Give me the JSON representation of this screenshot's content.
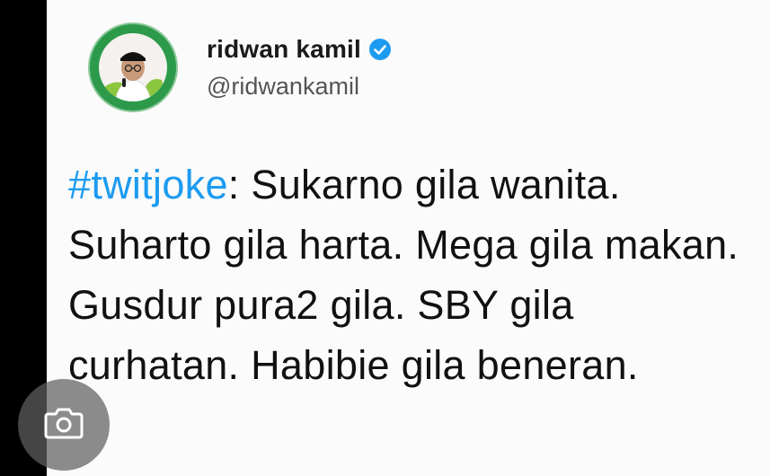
{
  "tweet": {
    "display_name": "ridwan kamil",
    "handle": "@ridwankamil",
    "hashtag": "#twitjoke",
    "text_after_hashtag": ": Sukarno gila wanita. Suharto gila harta. Mega gila makan. Gusdur pura2 gila. SBY gila curhatan. Habibie gila beneran."
  },
  "icons": {
    "verified": "verified-badge-icon",
    "avatar": "profile-photo",
    "overlay": "camera-icon"
  },
  "colors": {
    "hashtag": "#1d9bf0",
    "verified": "#1d9bf0",
    "avatar_ring": "#2c9a4a"
  }
}
